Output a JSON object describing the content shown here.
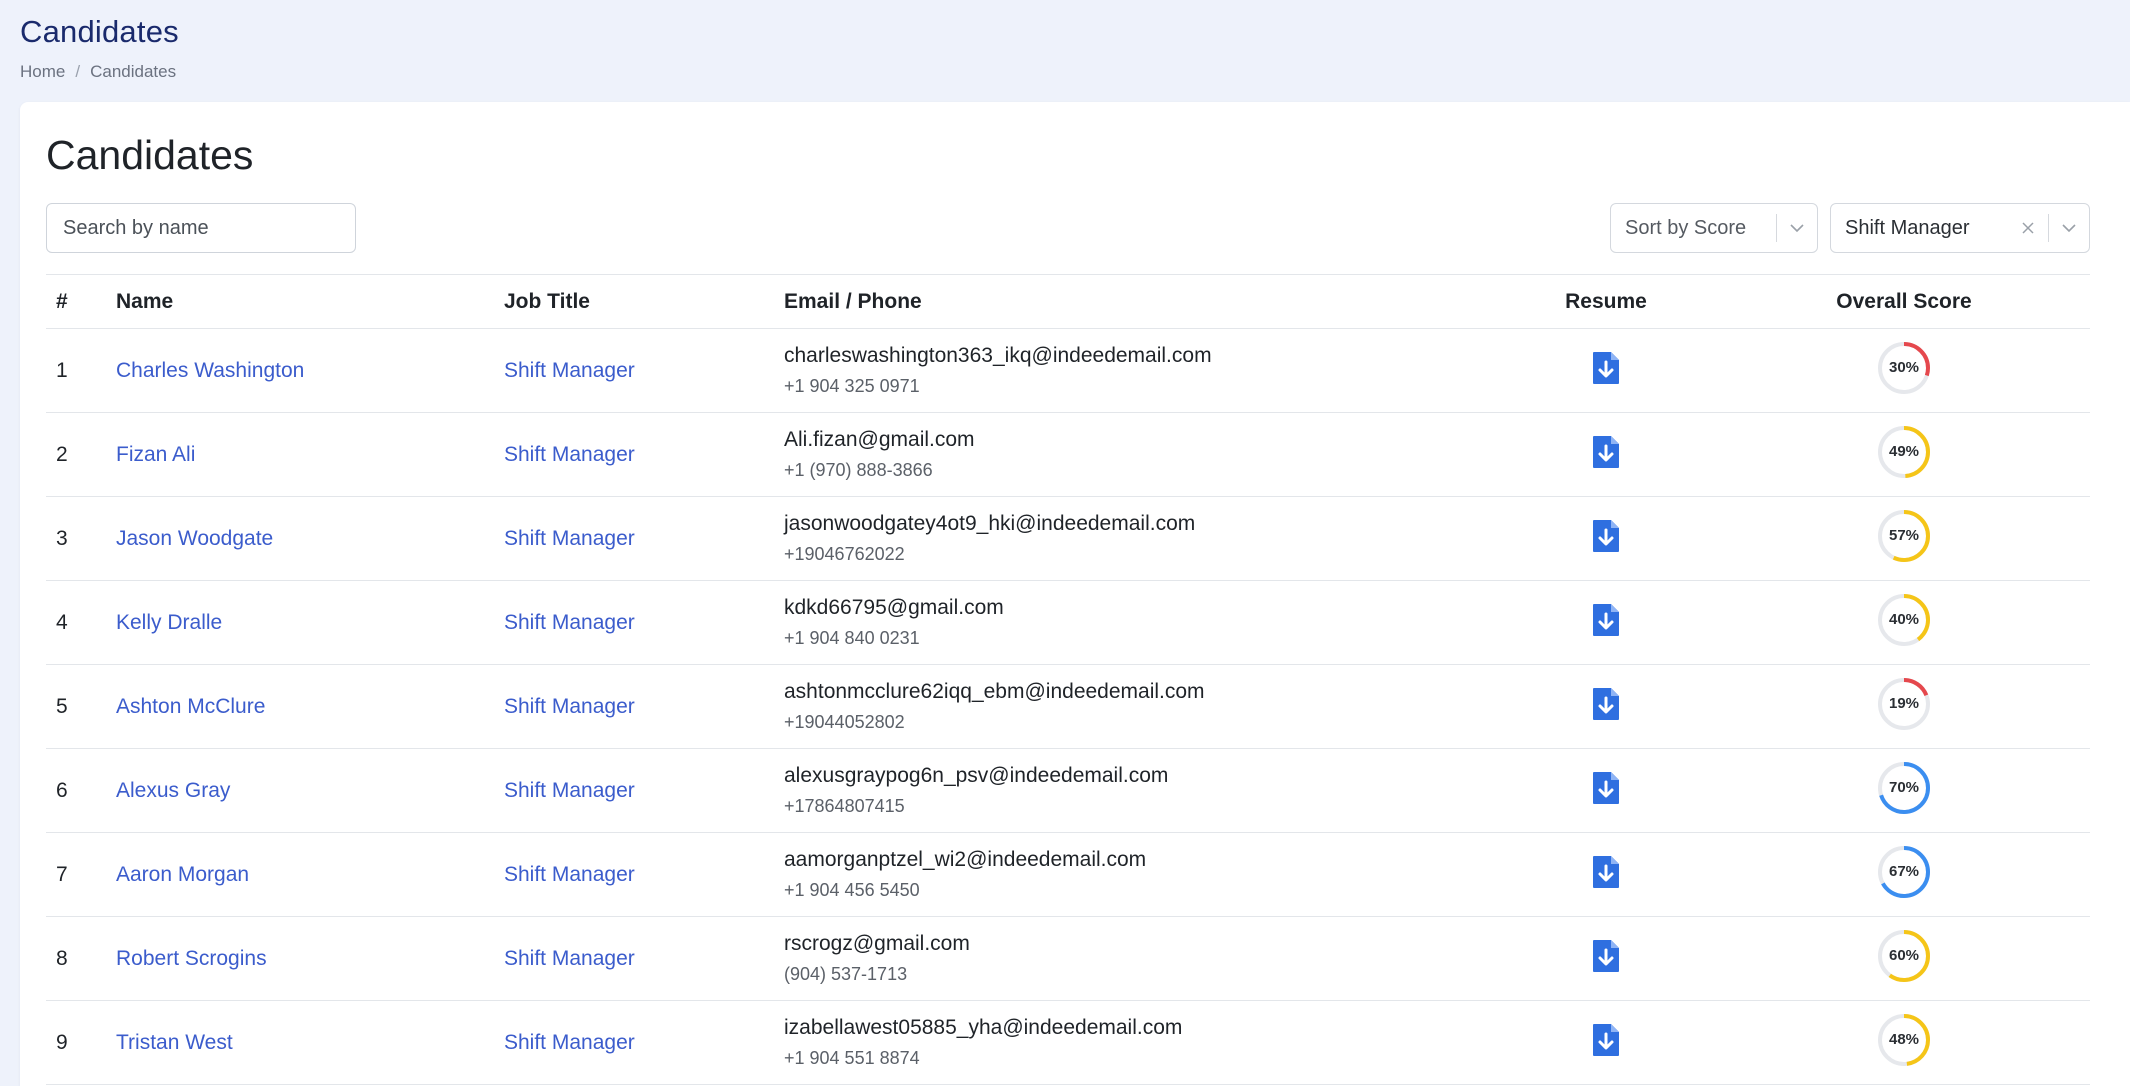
{
  "header": {
    "title": "Candidates",
    "breadcrumb": [
      "Home",
      "Candidates"
    ]
  },
  "main": {
    "title": "Candidates",
    "search_placeholder": "Search by name",
    "sort_value": "Sort by Score",
    "job_filter_value": "Shift Manager"
  },
  "table": {
    "columns": [
      "#",
      "Name",
      "Job Title",
      "Email / Phone",
      "Resume",
      "Overall Score"
    ],
    "rows": [
      {
        "num": "1",
        "name": "Charles Washington",
        "job": "Shift Manager",
        "email": "charleswashington363_ikq@indeedemail.com",
        "phone": "+1 904 325 0971",
        "score": 30,
        "score_label": "30%"
      },
      {
        "num": "2",
        "name": "Fizan Ali",
        "job": "Shift Manager",
        "email": "Ali.fizan@gmail.com",
        "phone": "+1 (970) 888-3866",
        "score": 49,
        "score_label": "49%"
      },
      {
        "num": "3",
        "name": "Jason Woodgate",
        "job": "Shift Manager",
        "email": "jasonwoodgatey4ot9_hki@indeedemail.com",
        "phone": "+19046762022",
        "score": 57,
        "score_label": "57%"
      },
      {
        "num": "4",
        "name": "Kelly Dralle",
        "job": "Shift Manager",
        "email": "kdkd66795@gmail.com",
        "phone": "+1 904 840 0231",
        "score": 40,
        "score_label": "40%"
      },
      {
        "num": "5",
        "name": "Ashton McClure",
        "job": "Shift Manager",
        "email": "ashtonmcclure62iqq_ebm@indeedemail.com",
        "phone": "+19044052802",
        "score": 19,
        "score_label": "19%"
      },
      {
        "num": "6",
        "name": "Alexus Gray",
        "job": "Shift Manager",
        "email": "alexusgraypog6n_psv@indeedemail.com",
        "phone": "+17864807415",
        "score": 70,
        "score_label": "70%"
      },
      {
        "num": "7",
        "name": "Aaron Morgan",
        "job": "Shift Manager",
        "email": "aamorganptzel_wi2@indeedemail.com",
        "phone": "+1 904 456 5450",
        "score": 67,
        "score_label": "67%"
      },
      {
        "num": "8",
        "name": "Robert Scrogins",
        "job": "Shift Manager",
        "email": "rscrogz@gmail.com",
        "phone": "(904) 537-1713",
        "score": 60,
        "score_label": "60%"
      },
      {
        "num": "9",
        "name": "Tristan West",
        "job": "Shift Manager",
        "email": "izabellawest05885_yha@indeedemail.com",
        "phone": "+1 904 551 8874",
        "score": 48,
        "score_label": "48%"
      }
    ]
  },
  "icons": {
    "resume": "file-download-icon",
    "clear": "close-icon",
    "dropdown": "chevron-down-icon"
  },
  "colors": {
    "link": "#3b5ccc",
    "resume_icon": "#2f6fe0",
    "score_low": "#e5484d",
    "score_mid": "#f5c518",
    "score_high": "#3b8ef0",
    "score_track": "#e6e8ec"
  }
}
